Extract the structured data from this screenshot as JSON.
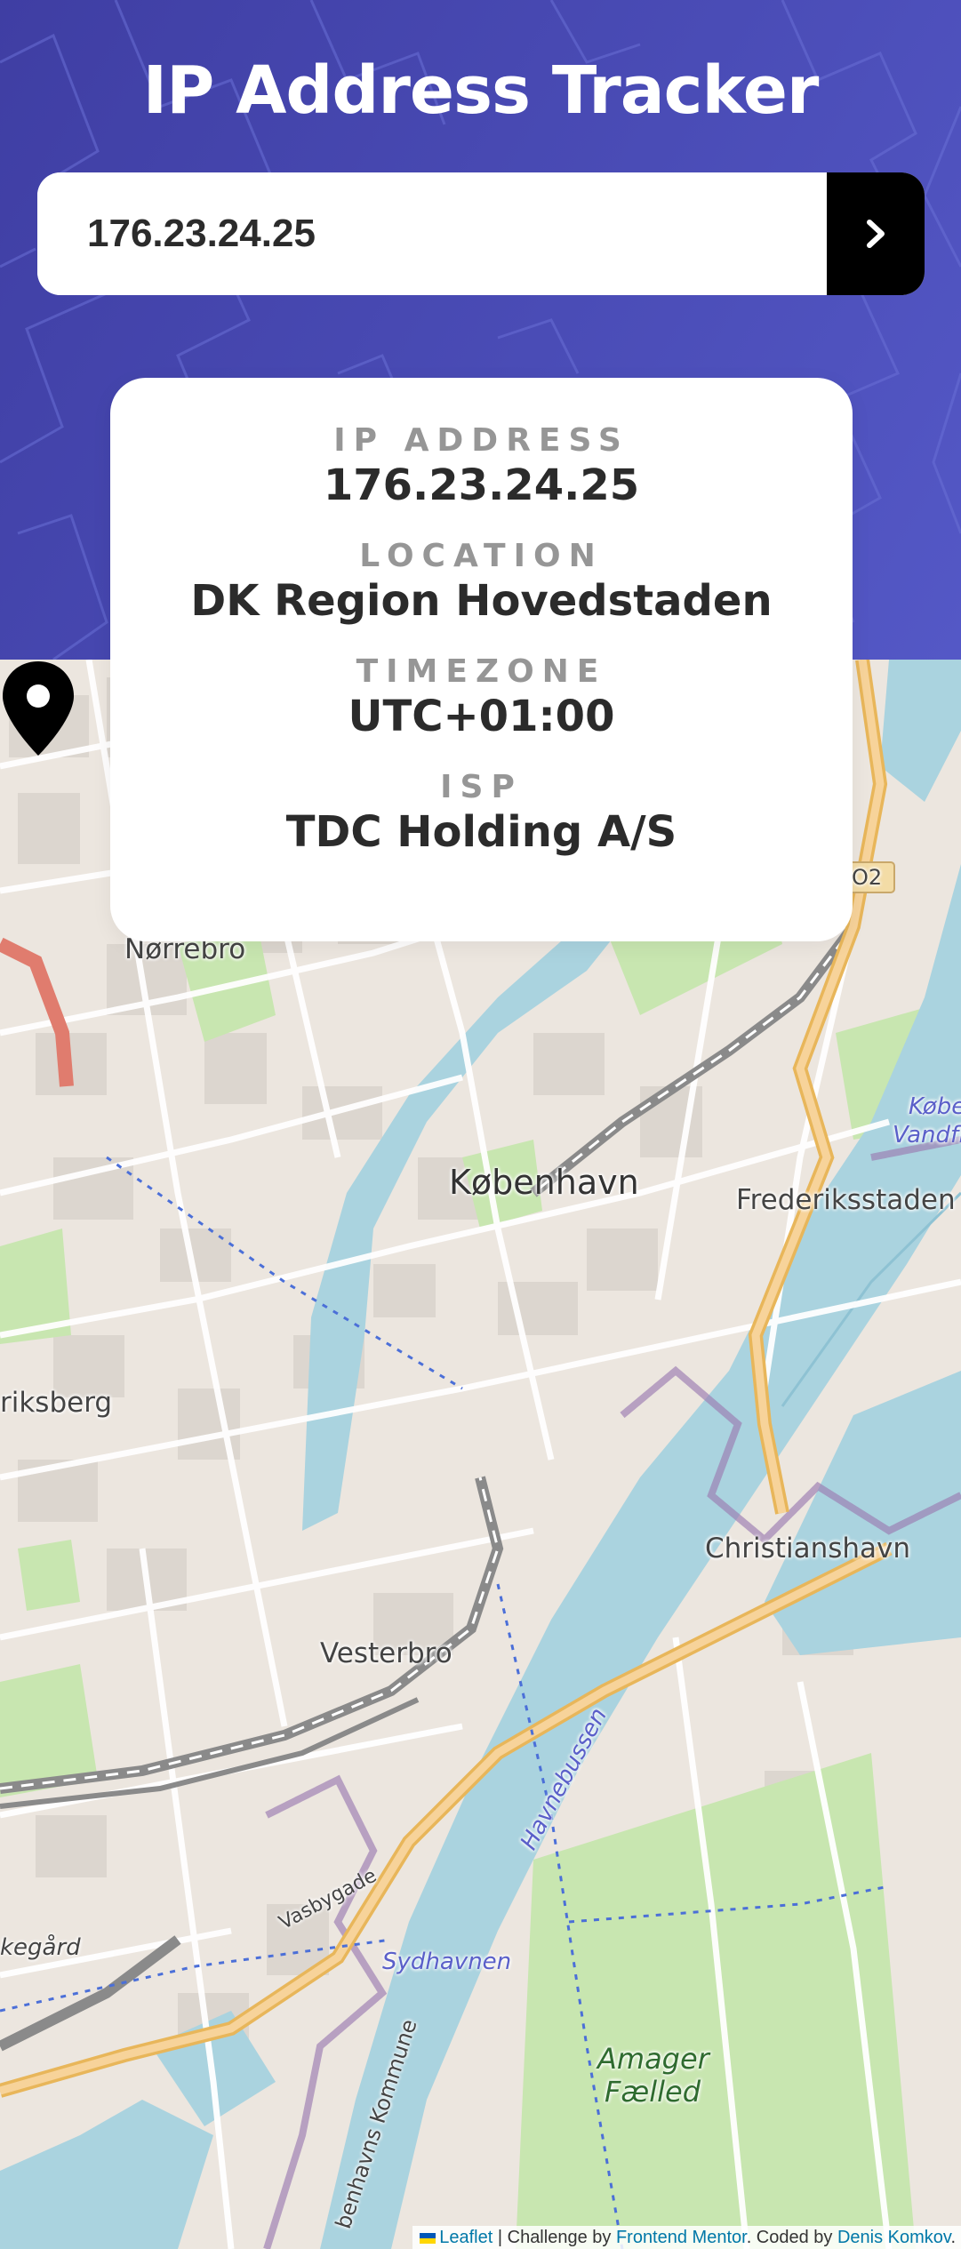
{
  "header": {
    "title": "IP Address Tracker"
  },
  "search": {
    "value": "176.23.24.25",
    "submit_icon": "chevron-right-icon"
  },
  "info": {
    "ip": {
      "label": "IP ADDRESS",
      "value": "176.23.24.25"
    },
    "location": {
      "label": "LOCATION",
      "value": "DK Region Hovedstaden"
    },
    "timezone": {
      "label": "TIMEZONE",
      "value": "UTC+01:00"
    },
    "isp": {
      "label": "ISP",
      "value": "TDC Holding A/S"
    }
  },
  "map": {
    "labels": {
      "norrebro": "Nørrebro",
      "kobenhavn": "København",
      "frederiksstaden": "Frederiksstaden",
      "frederiksberg": "riksberg",
      "christianshavn": "Christianshavn",
      "vesterbro": "Vesterbro",
      "kobe": "Købe",
      "vandfl": "Vandfl",
      "havnebussen": "Havnebussen",
      "sydhavnen": "Sydhavnen",
      "vasbygade": "Vasbygade",
      "kommune": "benhavns Kommune",
      "amager": "Amager",
      "faelled": "Fælled",
      "kegaard": "kegård",
      "road_badge": "O2"
    },
    "marker_icon": "location-pin-icon"
  },
  "attribution": {
    "leaflet": "Leaflet",
    "separator": " | Challenge by ",
    "frontend_mentor": "Frontend Mentor",
    "coded_by": ". Coded by ",
    "author": "Denis Komkov",
    "end": "."
  },
  "colors": {
    "header_bg": "#4a4cb6",
    "card_bg": "#ffffff",
    "label": "#969696",
    "value": "#2b2b2b",
    "button": "#000000",
    "water": "#aad3df",
    "park": "#c8e6b0",
    "road_major": "#f4c26b"
  }
}
